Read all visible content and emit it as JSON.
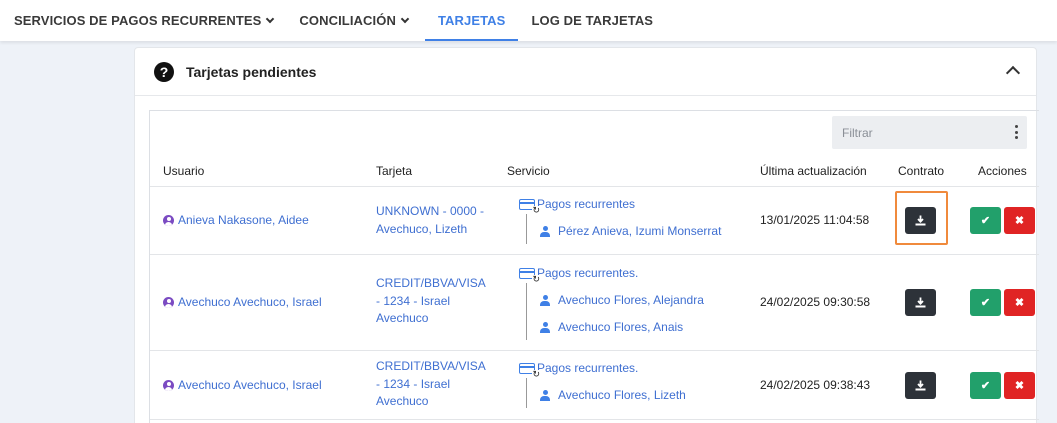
{
  "nav": {
    "items": [
      {
        "label": "SERVICIOS DE PAGOS RECURRENTES",
        "has_chevron": true,
        "active": false
      },
      {
        "label": "CONCILIACIÓN",
        "has_chevron": true,
        "active": false
      },
      {
        "label": "TARJETAS",
        "has_chevron": false,
        "active": true
      },
      {
        "label": "LOG DE TARJETAS",
        "has_chevron": false,
        "active": false
      }
    ]
  },
  "card": {
    "title": "Tarjetas pendientes",
    "help_icon": "question-circle-icon",
    "collapse_icon": "chevron-up-icon"
  },
  "filter": {
    "placeholder": "Filtrar",
    "value": ""
  },
  "table": {
    "headers": {
      "usuario": "Usuario",
      "tarjeta": "Tarjeta",
      "servicio": "Servicio",
      "actualizacion": "Última actualización",
      "contrato": "Contrato",
      "acciones": "Acciones"
    },
    "rows": [
      {
        "usuario": "Anieva Nakasone, Aidee",
        "tarjeta": "UNKNOWN - 0000 - Avechuco, Lizeth",
        "servicio": "Pagos recurrentes",
        "beneficiarios": [
          "Pérez Anieva, Izumi Monserrat"
        ],
        "actualizacion": "13/01/2025 11:04:58"
      },
      {
        "usuario": "Avechuco Avechuco, Israel",
        "tarjeta": "CREDIT/BBVA/VISA - 1234 - Israel Avechuco",
        "servicio": "Pagos recurrentes.",
        "beneficiarios": [
          "Avechuco Flores, Alejandra",
          "Avechuco Flores, Anais"
        ],
        "actualizacion": "24/02/2025 09:30:58"
      },
      {
        "usuario": "Avechuco Avechuco, Israel",
        "tarjeta": "CREDIT/BBVA/VISA - 1234 - Israel Avechuco",
        "servicio": "Pagos recurrentes.",
        "beneficiarios": [
          "Avechuco Flores, Lizeth"
        ],
        "actualizacion": "24/02/2025 09:38:43"
      }
    ]
  },
  "colors": {
    "accent": "#3f80e6",
    "link": "#3f6fd1",
    "approve": "#22a06b",
    "reject": "#e02424",
    "download": "#2d3239",
    "highlight": "#f08a3c"
  }
}
